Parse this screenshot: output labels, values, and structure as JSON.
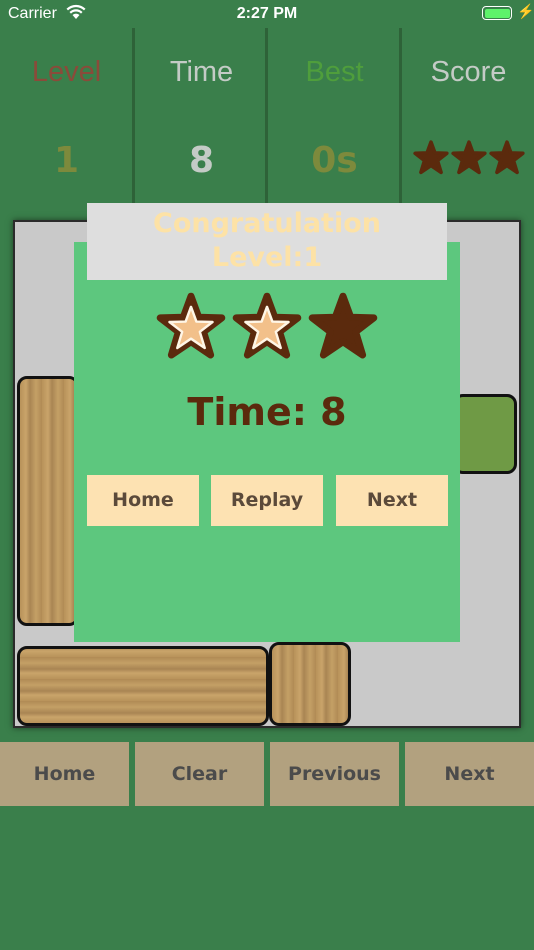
{
  "status_bar": {
    "carrier": "Carrier",
    "time": "2:27 PM",
    "wifi_icon": "wifi-icon",
    "battery_icon": "battery-icon"
  },
  "header": {
    "level": {
      "label": "Level",
      "value": "1",
      "label_color": "#8a4b3a",
      "value_color": "#7d8a3c"
    },
    "time": {
      "label": "Time",
      "value": "8",
      "label_color": "#c4cbc6",
      "value_color": "#c4cbc6"
    },
    "best": {
      "label": "Best",
      "value": "0s",
      "label_color": "#4f9e3c",
      "value_color": "#7d8a3c"
    },
    "score": {
      "label": "Score",
      "stars_earned": 3,
      "stars_total": 3,
      "label_color": "#c4cbc6",
      "star_color": "#5b2a0d"
    }
  },
  "dialog": {
    "title_line1": "Congratulation",
    "title_line2": "Level:1",
    "stars_earned": 2,
    "stars_total": 3,
    "time_text": "Time: 8",
    "buttons": [
      "Home",
      "Replay",
      "Next"
    ]
  },
  "bottom_bar": {
    "buttons": [
      "Home",
      "Clear",
      "Previous",
      "Next"
    ]
  },
  "colors": {
    "background": "#3a7f4b",
    "dialog": "#5dc77e",
    "dialog_button": "#fde2b2",
    "bottom_button": "#b2a17f",
    "star_dark": "#5b2a0d",
    "star_light": "#f2c08a"
  }
}
